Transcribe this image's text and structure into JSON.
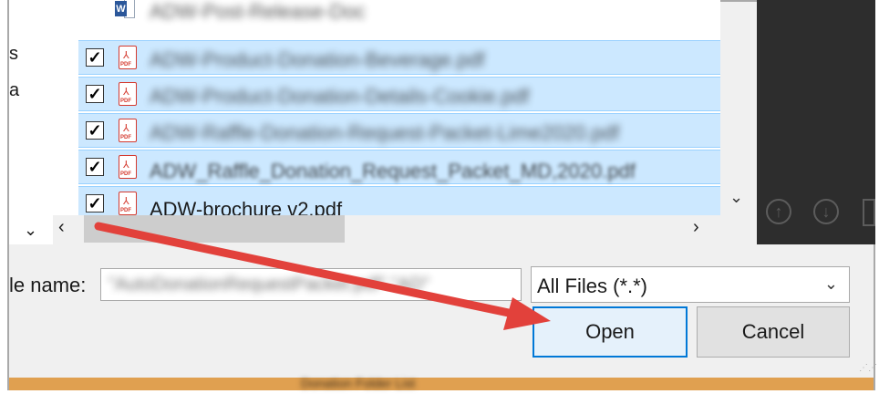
{
  "dialog": {
    "left_pane": {
      "clips": [
        "s",
        "a"
      ]
    },
    "files": [
      {
        "name": "ADW-Post-Release-Doc",
        "checked": false,
        "type": "word",
        "selected": false,
        "blurred": true
      },
      {
        "name": "ADW-Product-Donation-Beverage.pdf",
        "checked": true,
        "type": "pdf",
        "selected": true,
        "blurred": true
      },
      {
        "name": "ADW-Product-Donation-Details-Cookie.pdf",
        "checked": true,
        "type": "pdf",
        "selected": true,
        "blurred": true
      },
      {
        "name": "ADW-Raffle-Donation-Request-Packet-Lime2020.pdf",
        "checked": true,
        "type": "pdf",
        "selected": true,
        "blurred": true
      },
      {
        "name": "ADW_Raffle_Donation_Request_Packet_MD,2020.pdf",
        "checked": true,
        "type": "pdf",
        "selected": true,
        "blurred": true
      },
      {
        "name": "ADW-brochure v2.pdf",
        "checked": true,
        "type": "pdf",
        "selected": true,
        "blurred": false
      }
    ],
    "file_name_label": "le name:",
    "file_name_value": "\"AutoDonationRequestPacket.pdf\" \"AD\"",
    "file_type_filter": "All Files (*.*)",
    "open_label": "Open",
    "cancel_label": "Cancel",
    "bottom_bar_text": "Donation Folder List"
  },
  "colors": {
    "selection_bg": "#cce8ff",
    "selection_border": "#99d1ff",
    "primary_border": "#0078d7",
    "preview_bg": "#2d2d2d",
    "arrow": "#e2413b",
    "bottom_bar": "#e0a050"
  },
  "icons": [
    "checkmark-icon",
    "pdf-file-icon",
    "word-file-icon",
    "chevron-down-icon",
    "chevron-left-icon",
    "chevron-right-icon",
    "up-arrow-icon",
    "down-arrow-icon",
    "annotation-arrow"
  ]
}
